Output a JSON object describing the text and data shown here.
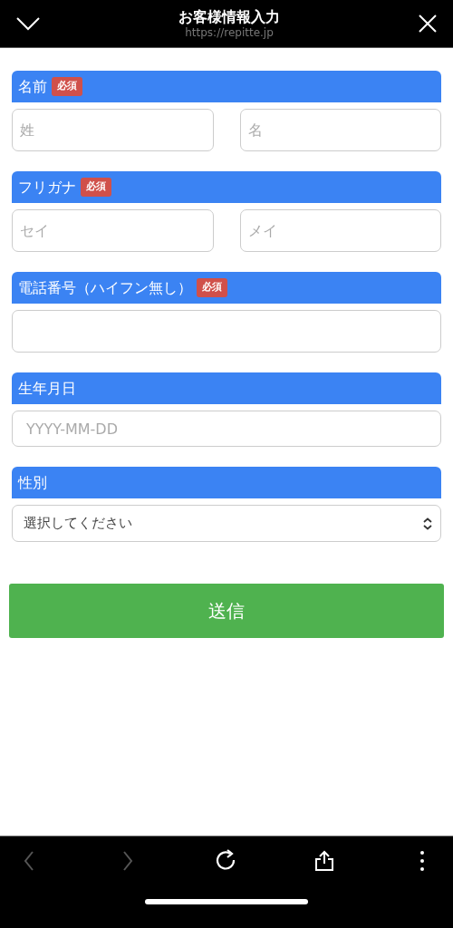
{
  "header": {
    "title": "お客様情報入力",
    "url": "https://repitte.jp"
  },
  "sections": [
    {
      "label": "名前",
      "badge": "必須",
      "fields": [
        {
          "kind": "input",
          "placeholder": "姓"
        },
        {
          "kind": "input",
          "placeholder": "名"
        }
      ]
    },
    {
      "label": "フリガナ",
      "badge": "必須",
      "fields": [
        {
          "kind": "input",
          "placeholder": "セイ"
        },
        {
          "kind": "input",
          "placeholder": "メイ"
        }
      ]
    },
    {
      "label": "電話番号（ハイフン無し）",
      "badge": "必須",
      "fields": [
        {
          "kind": "input"
        }
      ]
    },
    {
      "label": "生年月日",
      "fields": [
        {
          "kind": "input",
          "placeholder": "YYYY-MM-DD"
        }
      ]
    },
    {
      "label": "性別",
      "fields": [
        {
          "kind": "select",
          "value": "選択してください"
        }
      ]
    }
  ],
  "submit": "送信",
  "toolbar": [
    {
      "kind": "back",
      "disabled": true
    },
    {
      "kind": "forward",
      "disabled": true
    },
    {
      "kind": "reload",
      "disabled": false
    },
    {
      "kind": "share",
      "disabled": false
    },
    {
      "kind": "more",
      "disabled": false
    }
  ]
}
